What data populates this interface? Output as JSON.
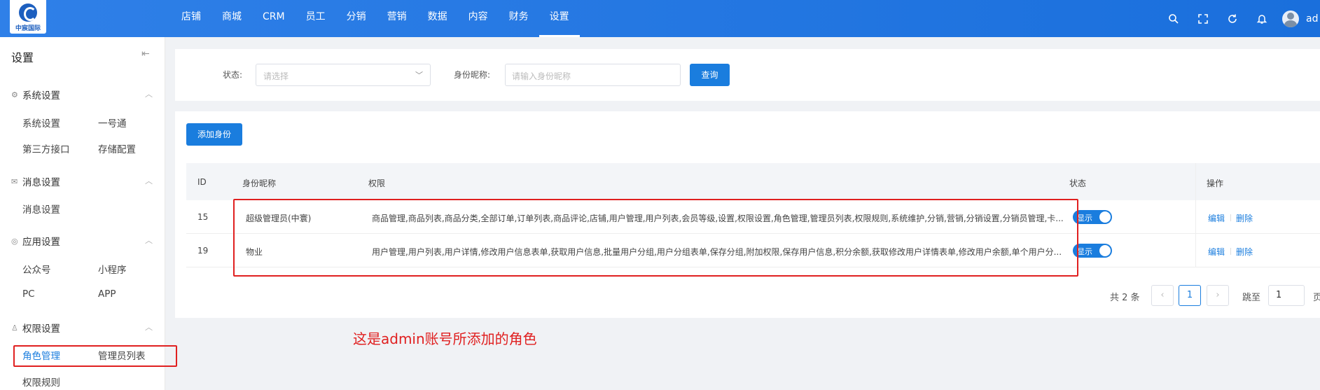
{
  "brand": {
    "logo_text": "中宸国际"
  },
  "nav": [
    "店铺",
    "商城",
    "CRM",
    "员工",
    "分销",
    "营销",
    "数据",
    "内容",
    "财务",
    "设置"
  ],
  "user": {
    "name": "ad"
  },
  "sidebar": {
    "title": "设置",
    "groups": [
      {
        "label": "系统设置",
        "items": [
          "系统设置",
          "一号通",
          "第三方接口",
          "存储配置"
        ]
      },
      {
        "label": "消息设置",
        "items": [
          "消息设置"
        ]
      },
      {
        "label": "应用设置",
        "items": [
          "公众号",
          "小程序",
          "PC",
          "APP"
        ]
      },
      {
        "label": "权限设置",
        "items": [
          "角色管理",
          "管理员列表",
          "权限规则"
        ]
      }
    ],
    "active_item": "角色管理"
  },
  "filter": {
    "status_label": "状态:",
    "status_placeholder": "请选择",
    "name_label": "身份昵称:",
    "name_placeholder": "请输入身份昵称",
    "query_button": "查询"
  },
  "add_button": "添加身份",
  "table": {
    "columns": [
      "ID",
      "身份昵称",
      "权限",
      "状态",
      "操作"
    ],
    "rows": [
      {
        "id": "15",
        "name": "超级管理员(中寰)",
        "permissions": "商品管理,商品列表,商品分类,全部订单,订单列表,商品评论,店铺,用户管理,用户列表,会员等级,设置,权限设置,角色管理,管理员列表,权限规则,系统维护,分销,营销,分销设置,分销员管理,卡...",
        "status": "显示",
        "actions": [
          "编辑",
          "删除"
        ]
      },
      {
        "id": "19",
        "name": "物业",
        "permissions": "用户管理,用户列表,用户详情,修改用户信息表单,获取用户信息,批量用户分组,用户分组表单,保存分组,附加权限,保存用户信息,积分余额,获取修改用户详情表单,修改用户余额,单个用户分...",
        "status": "显示",
        "actions": [
          "编辑",
          "删除"
        ]
      }
    ]
  },
  "pagination": {
    "total": "共 2 条",
    "prev": "‹",
    "current": "1",
    "next": "›",
    "goto_label": "跳至",
    "goto_value": "1",
    "page_suffix": "页"
  },
  "annotation": "这是admin账号所添加的角色",
  "colors": {
    "primary": "#1a7dde",
    "highlight": "#e02020"
  }
}
